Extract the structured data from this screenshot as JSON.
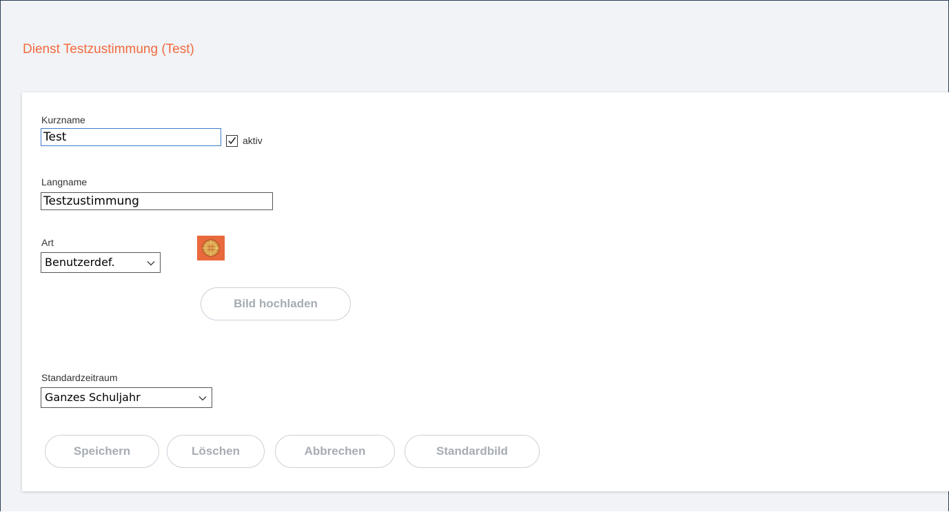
{
  "page": {
    "title": "Dienst Testzustimmung (Test)"
  },
  "form": {
    "kurzname": {
      "label": "Kurzname",
      "value": "Test"
    },
    "aktiv": {
      "label": "aktiv",
      "checked": true
    },
    "langname": {
      "label": "Langname",
      "value": "Testzustimmung"
    },
    "art": {
      "label": "Art",
      "selected": "Benutzerdef."
    },
    "image": {
      "icon": "custom-image-thumbnail-icon"
    },
    "upload_label": "Bild hochladen",
    "standardzeitraum": {
      "label": "Standardzeitraum",
      "selected": "Ganzes Schuljahr"
    }
  },
  "actions": {
    "save": "Speichern",
    "delete": "Löschen",
    "cancel": "Abbrechen",
    "default_image": "Standardbild"
  },
  "colors": {
    "title": "#f26a3e",
    "focus_border": "#3d7cc9",
    "button_text": "#a6acb3",
    "button_border": "#c9d0d8",
    "background": "#f1f3f6"
  }
}
